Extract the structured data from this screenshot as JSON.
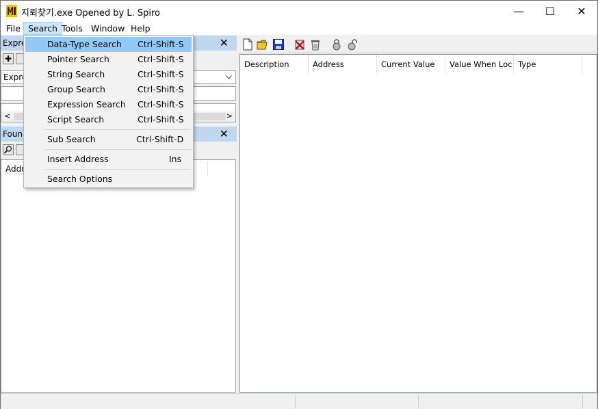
{
  "window": {
    "title": "지뢰찾기.exe Opened by L. Spiro",
    "minimize_glyph": "—",
    "maximize_glyph": "☐",
    "close_glyph": "✕"
  },
  "menubar": {
    "items": [
      {
        "label": "File"
      },
      {
        "label": "Search"
      },
      {
        "label": "Tools"
      },
      {
        "label": "Window"
      },
      {
        "label": "Help"
      }
    ]
  },
  "left": {
    "expr_panel_title": "Expre",
    "expr_panel_close": "✕",
    "add_glyph": "✚",
    "expr_dropdown_value": "Expres",
    "scroll_left": "<",
    "scroll_right": ">",
    "found_panel_title": "Found",
    "found_panel_close": "✕",
    "found_list_header": "Addr"
  },
  "right": {
    "columns": [
      "Description",
      "Address",
      "Current Value",
      "Value When Loc…",
      "Type"
    ]
  },
  "search_menu": {
    "items": [
      {
        "label": "Data-Type Search",
        "shortcut": "Ctrl-Shift-S",
        "highlighted": true
      },
      {
        "label": "Pointer Search",
        "shortcut": "Ctrl-Shift-S"
      },
      {
        "label": "String Search",
        "shortcut": "Ctrl-Shift-S"
      },
      {
        "label": "Group Search",
        "shortcut": "Ctrl-Shift-S"
      },
      {
        "label": "Expression Search",
        "shortcut": "Ctrl-Shift-S"
      },
      {
        "label": "Script Search",
        "shortcut": "Ctrl-Shift-S"
      },
      {
        "label": "Sub Search",
        "shortcut": "Ctrl-Shift-D"
      },
      {
        "label": "Insert Address",
        "shortcut": "Ins"
      },
      {
        "label": "Search Options",
        "shortcut": ""
      }
    ]
  },
  "colors": {
    "highlight": "#91c9f7",
    "panel_header": "#c0d7ef",
    "menu_active": "#cce8ff"
  },
  "icons": {
    "app": "app-icon",
    "toolbar": [
      "new-file-icon",
      "open-folder-icon",
      "save-icon",
      "delete-icon",
      "clear-icon",
      "lock-icon",
      "unlock-icon"
    ]
  }
}
